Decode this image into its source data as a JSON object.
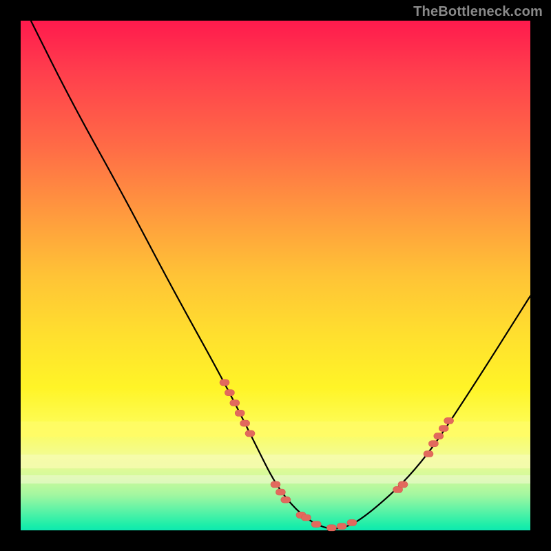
{
  "watermark": "TheBottleneck.com",
  "colors": {
    "frame_bg": "#000000",
    "marker": "#e2695d",
    "curve": "#000000"
  },
  "chart_data": {
    "type": "line",
    "title": "",
    "xlabel": "",
    "ylabel": "",
    "xlim": [
      0,
      100
    ],
    "ylim": [
      0,
      100
    ],
    "series": [
      {
        "name": "bottleneck-curve",
        "x": [
          2,
          10,
          20,
          30,
          40,
          46,
          50,
          54,
          58,
          62,
          67,
          78,
          88,
          100
        ],
        "y": [
          100,
          84,
          66,
          47,
          29,
          17,
          9,
          4,
          1,
          0,
          2,
          12,
          27,
          46
        ]
      }
    ],
    "markers": {
      "name": "highlight-points",
      "points": [
        {
          "x": 40,
          "y": 29
        },
        {
          "x": 41,
          "y": 27
        },
        {
          "x": 42,
          "y": 25
        },
        {
          "x": 43,
          "y": 23
        },
        {
          "x": 44,
          "y": 21
        },
        {
          "x": 45,
          "y": 19
        },
        {
          "x": 50,
          "y": 9
        },
        {
          "x": 51,
          "y": 7.5
        },
        {
          "x": 52,
          "y": 6
        },
        {
          "x": 55,
          "y": 3
        },
        {
          "x": 56,
          "y": 2.5
        },
        {
          "x": 58,
          "y": 1.2
        },
        {
          "x": 61,
          "y": 0.5
        },
        {
          "x": 63,
          "y": 0.8
        },
        {
          "x": 65,
          "y": 1.5
        },
        {
          "x": 74,
          "y": 8
        },
        {
          "x": 75,
          "y": 9
        },
        {
          "x": 80,
          "y": 15
        },
        {
          "x": 81,
          "y": 17
        },
        {
          "x": 82,
          "y": 18.5
        },
        {
          "x": 83,
          "y": 20
        },
        {
          "x": 84,
          "y": 21.5
        }
      ]
    }
  }
}
